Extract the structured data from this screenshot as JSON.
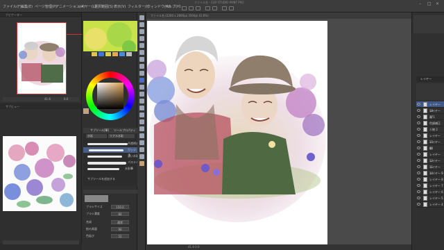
{
  "menubar": {
    "title": "ファイル名 - CLIP STUDIO PAINT PRO",
    "items": [
      "ファイル(F)",
      "編集(E)",
      "ページ管理(P)",
      "アニメーション(A)",
      "レイヤー(L)",
      "選択範囲(S)",
      "表示(V)",
      "フィルター(I)",
      "ウィンドウ(W)",
      "ヘルプ(H)"
    ]
  },
  "navigator": {
    "tab": "ナビゲーター",
    "zoom": "41.6",
    "angle": "0.0"
  },
  "subview": {
    "tab": "サブビュー"
  },
  "tool_property": {
    "tabs": [
      "サブツール[筆]",
      "ツールプロパティ"
    ],
    "groups": [
      "水彩",
      "リアル水彩"
    ],
    "brushes": [
      "不透明水彩",
      "ガッシュ",
      "濃い水彩",
      "パステル",
      "水彩筆"
    ],
    "add_button": "サブツールを追加する",
    "props": [
      {
        "label": "ブラシサイズ",
        "value": "150.0"
      },
      {
        "label": "ブラシ濃度",
        "value": "84"
      },
      {
        "label": "合成",
        "value": "通常"
      },
      {
        "label": "絵の具量",
        "value": "90"
      },
      {
        "label": "色延び",
        "value": "52"
      }
    ]
  },
  "canvas": {
    "tab": "ファイル名 (2200 x 2800px 350dpi 41.6%)",
    "status": "41.6    0.0"
  },
  "layers": {
    "header": "レイヤー",
    "items": [
      "レイヤー 18",
      "レイヤー 17",
      "花 1",
      "色調補正",
      "人物 2",
      "レイヤー 15",
      "レイヤー 14",
      "紙",
      "レイヤー 12",
      "レイヤー 11",
      "レイヤー 10",
      "レイヤー 9",
      "レイヤー 8",
      "レイヤー 7",
      "レイヤー 6",
      "レイヤー 5",
      "レイヤー 4"
    ]
  },
  "colors": {
    "accent": "#3a7bd5",
    "canvas_bg": "#4a4a4a",
    "panel_bg": "#303030",
    "main_color": "#c9a070"
  }
}
